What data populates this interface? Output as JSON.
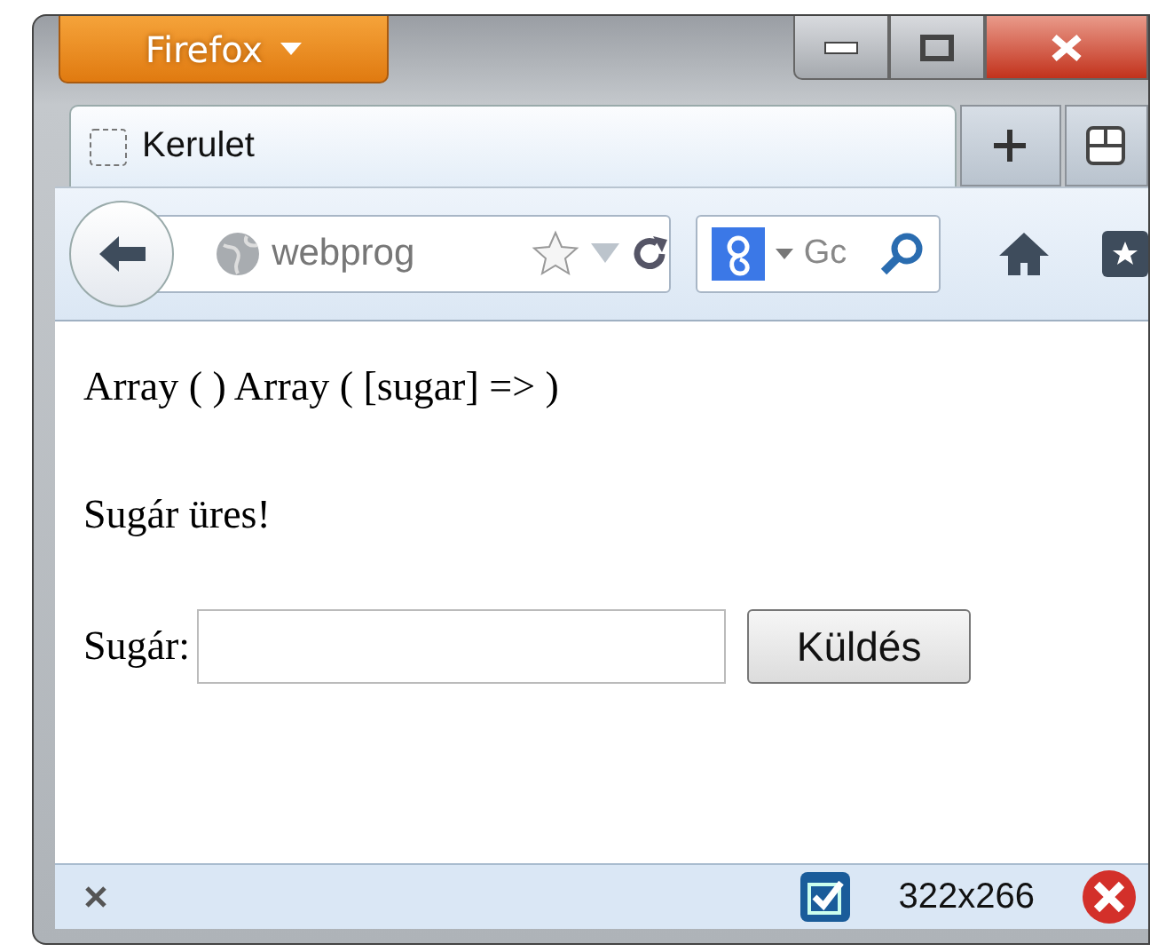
{
  "window": {
    "app_button": "Firefox"
  },
  "tabs": [
    {
      "label": "Kerulet",
      "selected": true
    }
  ],
  "nav": {
    "address": "webprog",
    "search_placeholder": "Gc"
  },
  "content": {
    "lines": [
      "Array ( ) Array ( [sugar] => )",
      "Sugár üres!"
    ],
    "form": {
      "label": "Sugár:",
      "button": "Küldés"
    }
  },
  "status_bar": {
    "size": "322x266"
  }
}
